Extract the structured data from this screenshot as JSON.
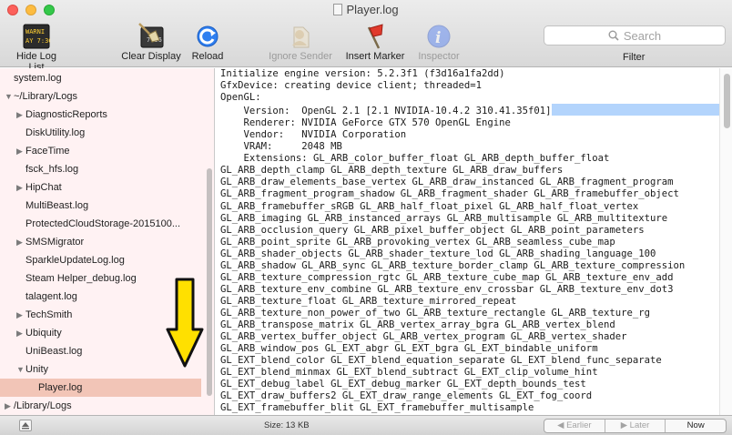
{
  "window": {
    "title": "Player.log"
  },
  "toolbar": {
    "hide_log_list": "Hide Log List",
    "clear_display": "Clear Display",
    "reload": "Reload",
    "ignore_sender": "Ignore Sender",
    "insert_marker": "Insert Marker",
    "inspector": "Inspector",
    "hide_icon_text_1": "WARNI",
    "hide_icon_text_2": "AY 7:36",
    "clear_icon_text": "7:36",
    "search_placeholder": "Search",
    "filter_label": "Filter"
  },
  "sidebar": {
    "items": [
      {
        "label": "system.log",
        "disclosure": "",
        "indent": 0
      },
      {
        "label": "~/Library/Logs",
        "disclosure": "▼",
        "indent": 0
      },
      {
        "label": "DiagnosticReports",
        "disclosure": "▶",
        "indent": 1
      },
      {
        "label": "DiskUtility.log",
        "disclosure": "",
        "indent": 1
      },
      {
        "label": "FaceTime",
        "disclosure": "▶",
        "indent": 1
      },
      {
        "label": "fsck_hfs.log",
        "disclosure": "",
        "indent": 1
      },
      {
        "label": "HipChat",
        "disclosure": "▶",
        "indent": 1
      },
      {
        "label": "MultiBeast.log",
        "disclosure": "",
        "indent": 1
      },
      {
        "label": "ProtectedCloudStorage-2015100...",
        "disclosure": "",
        "indent": 1
      },
      {
        "label": "SMSMigrator",
        "disclosure": "▶",
        "indent": 1
      },
      {
        "label": "SparkleUpdateLog.log",
        "disclosure": "",
        "indent": 1
      },
      {
        "label": "Steam Helper_debug.log",
        "disclosure": "",
        "indent": 1
      },
      {
        "label": "talagent.log",
        "disclosure": "",
        "indent": 1
      },
      {
        "label": "TechSmith",
        "disclosure": "▶",
        "indent": 1
      },
      {
        "label": "Ubiquity",
        "disclosure": "▶",
        "indent": 1
      },
      {
        "label": "UniBeast.log",
        "disclosure": "",
        "indent": 1
      },
      {
        "label": "Unity",
        "disclosure": "▼",
        "indent": 1
      },
      {
        "label": "Player.log",
        "disclosure": "",
        "indent": 2,
        "selected": true
      },
      {
        "label": "/Library/Logs",
        "disclosure": "▶",
        "indent": 0
      }
    ]
  },
  "log": {
    "lines": [
      "Initialize engine version: 5.2.3f1 (f3d16a1fa2dd)",
      "GfxDevice: creating device client; threaded=1",
      "OpenGL:",
      "    Version:  OpenGL 2.1 [2.1 NVIDIA-10.4.2 310.41.35f01]",
      "    Renderer: NVIDIA GeForce GTX 570 OpenGL Engine",
      "    Vendor:   NVIDIA Corporation",
      "    VRAM:     2048 MB",
      "    Extensions: GL_ARB_color_buffer_float GL_ARB_depth_buffer_float",
      "GL_ARB_depth_clamp GL_ARB_depth_texture GL_ARB_draw_buffers",
      "GL_ARB_draw_elements_base_vertex GL_ARB_draw_instanced GL_ARB_fragment_program",
      "GL_ARB_fragment_program_shadow GL_ARB_fragment_shader GL_ARB_framebuffer_object",
      "GL_ARB_framebuffer_sRGB GL_ARB_half_float_pixel GL_ARB_half_float_vertex",
      "GL_ARB_imaging GL_ARB_instanced_arrays GL_ARB_multisample GL_ARB_multitexture",
      "GL_ARB_occlusion_query GL_ARB_pixel_buffer_object GL_ARB_point_parameters",
      "GL_ARB_point_sprite GL_ARB_provoking_vertex GL_ARB_seamless_cube_map",
      "GL_ARB_shader_objects GL_ARB_shader_texture_lod GL_ARB_shading_language_100",
      "GL_ARB_shadow GL_ARB_sync GL_ARB_texture_border_clamp GL_ARB_texture_compression",
      "GL_ARB_texture_compression_rgtc GL_ARB_texture_cube_map GL_ARB_texture_env_add",
      "GL_ARB_texture_env_combine GL_ARB_texture_env_crossbar GL_ARB_texture_env_dot3",
      "GL_ARB_texture_float GL_ARB_texture_mirrored_repeat",
      "GL_ARB_texture_non_power_of_two GL_ARB_texture_rectangle GL_ARB_texture_rg",
      "GL_ARB_transpose_matrix GL_ARB_vertex_array_bgra GL_ARB_vertex_blend",
      "GL_ARB_vertex_buffer_object GL_ARB_vertex_program GL_ARB_vertex_shader",
      "GL_ARB_window_pos GL_EXT_abgr GL_EXT_bgra GL_EXT_bindable_uniform",
      "GL_EXT_blend_color GL_EXT_blend_equation_separate GL_EXT_blend_func_separate",
      "GL_EXT_blend_minmax GL_EXT_blend_subtract GL_EXT_clip_volume_hint",
      "GL_EXT_debug_label GL_EXT_debug_marker GL_EXT_depth_bounds_test",
      "GL_EXT_draw_buffers2 GL_EXT_draw_range_elements GL_EXT_fog_coord",
      "GL_EXT_framebuffer_blit GL_EXT_framebuffer_multisample"
    ]
  },
  "status": {
    "size": "Size: 13 KB",
    "earlier": "Earlier",
    "later": "Later",
    "now": "Now"
  },
  "colors": {
    "selection": "#f2c5b7",
    "sidebar_bg": "#fff2f3",
    "highlight": "#b3d4fc",
    "arrow": "#ffe000"
  }
}
